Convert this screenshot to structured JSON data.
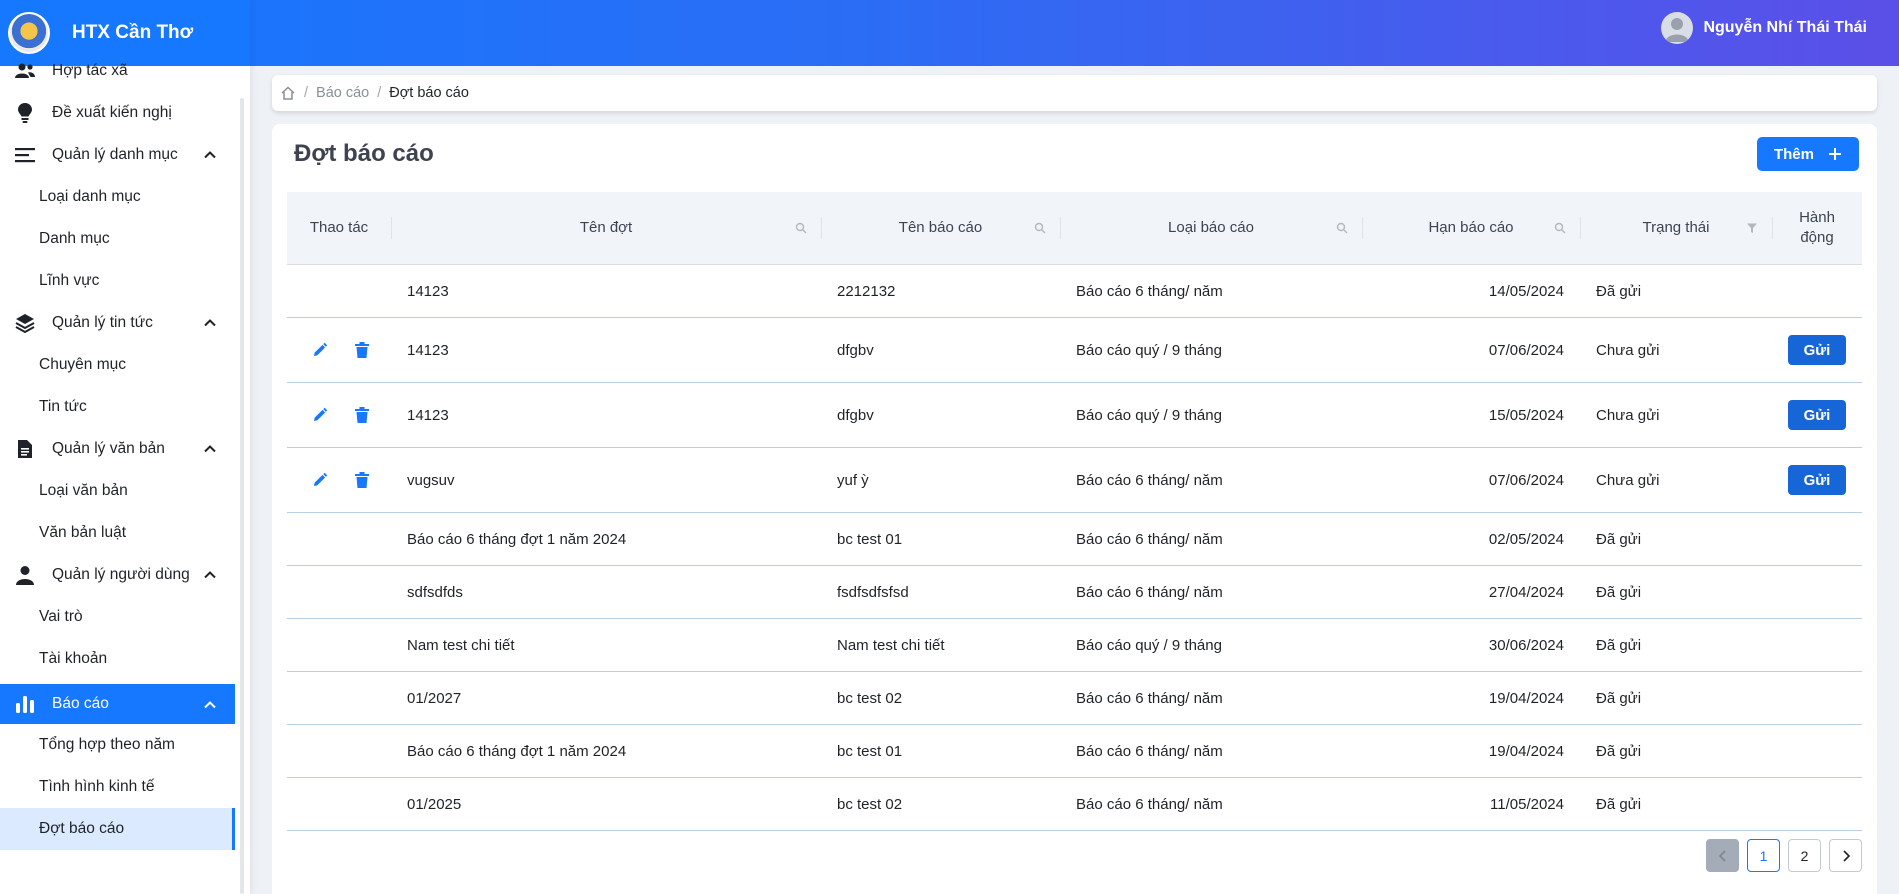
{
  "brand": {
    "name": "HTX Cần Thơ"
  },
  "user": {
    "name": "Nguyễn Nhí Thái Thái"
  },
  "sidebar": {
    "items": [
      {
        "label": "Hợp tác xã",
        "icon": "users-icon"
      },
      {
        "label": "Đề xuất kiến nghị",
        "icon": "lightbulb-icon"
      },
      {
        "label": "Quản lý danh mục",
        "icon": "menu-icon",
        "sub": [
          "Loại danh mục",
          "Danh mục",
          "Lĩnh vực"
        ]
      },
      {
        "label": "Quản lý tin tức",
        "icon": "layers-icon",
        "sub": [
          "Chuyên mục",
          "Tin tức"
        ]
      },
      {
        "label": "Quản lý văn bản",
        "icon": "document-icon",
        "sub": [
          "Loại văn bản",
          "Văn bản luật"
        ]
      },
      {
        "label": "Quản lý người dùng",
        "icon": "user-icon",
        "sub": [
          "Vai trò",
          "Tài khoản"
        ]
      },
      {
        "label": "Báo cáo",
        "icon": "bar-chart-icon",
        "active": true,
        "sub": [
          "Tổng hợp theo năm",
          "Tình hình kinh tế",
          "Đợt báo cáo"
        ]
      }
    ]
  },
  "breadcrumb": {
    "items": [
      "Báo cáo",
      "Đợt báo cáo"
    ]
  },
  "page": {
    "title": "Đợt báo cáo",
    "add_label": "Thêm"
  },
  "table": {
    "headers": {
      "actions": "Thao tác",
      "name": "Tên đợt",
      "report": "Tên báo cáo",
      "type": "Loại báo cáo",
      "due": "Hạn báo cáo",
      "status": "Trạng thái",
      "do": "Hành động"
    },
    "send_label": "Gửi",
    "rows": [
      {
        "name": "14123",
        "report": "2212132",
        "type": "Báo cáo 6 tháng/ năm",
        "due": "14/05/2024",
        "status": "Đã gửi",
        "editable": false
      },
      {
        "name": "14123",
        "report": "dfgbv",
        "type": "Báo cáo quý / 9 tháng",
        "due": "07/06/2024",
        "status": "Chưa gửi",
        "editable": true
      },
      {
        "name": "14123",
        "report": "dfgbv",
        "type": "Báo cáo quý / 9 tháng",
        "due": "15/05/2024",
        "status": "Chưa gửi",
        "editable": true
      },
      {
        "name": "vugsuv",
        "report": "yuf ỳ",
        "type": "Báo cáo 6 tháng/ năm",
        "due": "07/06/2024",
        "status": "Chưa gửi",
        "editable": true
      },
      {
        "name": "Báo cáo 6 tháng đợt 1 năm 2024",
        "report": "bc test 01",
        "type": "Báo cáo 6 tháng/ năm",
        "due": "02/05/2024",
        "status": "Đã gửi",
        "editable": false
      },
      {
        "name": "sdfsdfds",
        "report": "fsdfsdfsfsd",
        "type": "Báo cáo 6 tháng/ năm",
        "due": "27/04/2024",
        "status": "Đã gửi",
        "editable": false
      },
      {
        "name": "Nam test chi tiết",
        "report": "Nam test chi tiết",
        "type": "Báo cáo quý / 9 tháng",
        "due": "30/06/2024",
        "status": "Đã gửi",
        "editable": false
      },
      {
        "name": "01/2027",
        "report": "bc test 02",
        "type": "Báo cáo 6 tháng/ năm",
        "due": "19/04/2024",
        "status": "Đã gửi",
        "editable": false
      },
      {
        "name": "Báo cáo 6 tháng đợt 1 năm 2024",
        "report": "bc test 01",
        "type": "Báo cáo 6 tháng/ năm",
        "due": "19/04/2024",
        "status": "Đã gửi",
        "editable": false
      },
      {
        "name": "01/2025",
        "report": "bc test 02",
        "type": "Báo cáo 6 tháng/ năm",
        "due": "11/05/2024",
        "status": "Đã gửi",
        "editable": false
      }
    ]
  },
  "pagination": {
    "pages": [
      "1",
      "2"
    ],
    "current": "1"
  }
}
